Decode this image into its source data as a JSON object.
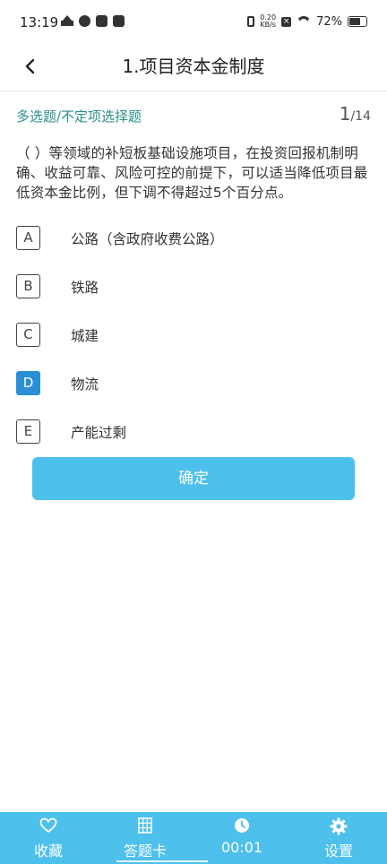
{
  "status_bar": {
    "time": "13:19",
    "net_speed_value": "0.20",
    "net_speed_unit": "KB/s",
    "battery_percent": "72%",
    "battery_level": 0.72
  },
  "header": {
    "title": "1.项目资本金制度"
  },
  "question": {
    "type_label": "多选题/不定项选择题",
    "current": "1",
    "total": "/14",
    "text": "（ ）等领域的补短板基础设施项目，在投资回报机制明确、收益可靠、风险可控的前提下，可以适当降低项目最低资本金比例，但下调不得超过5个百分点。"
  },
  "options": [
    {
      "letter": "A",
      "text": "公路（含政府收费公路）",
      "selected": false
    },
    {
      "letter": "B",
      "text": "铁路",
      "selected": false
    },
    {
      "letter": "C",
      "text": "城建",
      "selected": false
    },
    {
      "letter": "D",
      "text": "物流",
      "selected": true
    },
    {
      "letter": "E",
      "text": "产能过剩",
      "selected": false
    }
  ],
  "confirm_label": "确定",
  "bottom_nav": {
    "favorite_label": "收藏",
    "answer_card_label": "答题卡",
    "timer_label": "00:01",
    "settings_label": "设置"
  },
  "colors": {
    "accent": "#4dc0ec",
    "selected": "#2b8fd6",
    "question_type": "#2a8f8a"
  }
}
